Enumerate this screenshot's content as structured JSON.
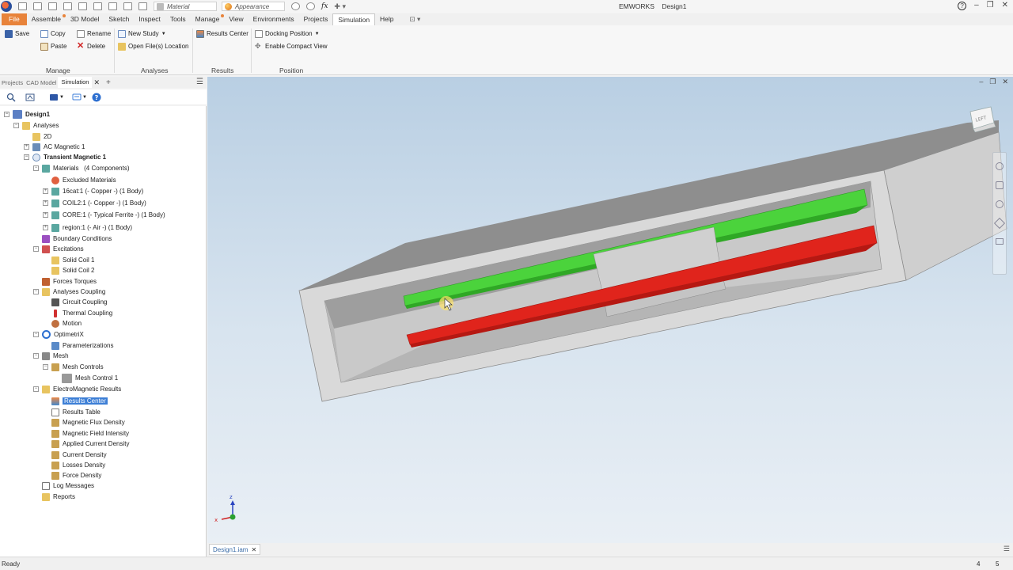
{
  "titlebar": {
    "app_title": "EMWORKS",
    "doc_title": "Design1",
    "material_combo": "Material",
    "appearance_combo": "Appearance",
    "help_symbol": "?"
  },
  "menu": {
    "items": [
      "File",
      "Assemble",
      "3D Model",
      "Sketch",
      "Inspect",
      "Tools",
      "Manage",
      "View",
      "Environments",
      "Projects",
      "Simulation",
      "Help"
    ],
    "active": "Simulation"
  },
  "ribbon": {
    "save": "Save",
    "copy": "Copy",
    "paste": "Paste",
    "rename": "Rename",
    "delete": "Delete",
    "new_study": "New Study",
    "open_location": "Open File(s) Location",
    "results_center": "Results Center",
    "docking_position": "Docking Position",
    "compact_view": "Enable Compact View",
    "groups": {
      "manage": "Manage",
      "analyses": "Analyses",
      "results": "Results",
      "position": "Position"
    }
  },
  "panel": {
    "tabs": [
      "Projects",
      "CAD Model",
      "Simulation"
    ],
    "active_tab": "Simulation",
    "plus": "+",
    "menu": "☰"
  },
  "tree": {
    "design": "Design1",
    "analyses": "Analyses",
    "twoD": "2D",
    "ac_magnetic": "AC Magnetic 1",
    "transient": "Transient Magnetic 1",
    "materials": "Materials",
    "materials_count": "(4 Components)",
    "excluded": "Excluded Materials",
    "mat1": "16cat:1   (- Copper -)  (1 Body)",
    "mat2": "COIL2:1   (- Copper -)  (1 Body)",
    "mat3": "CORE:1   (- Typical Ferrite -)  (1 Body)",
    "mat4": "region:1   (- Air -)  (1 Body)",
    "boundary": "Boundary Conditions",
    "excitations": "Excitations",
    "coil1": "Solid Coil 1",
    "coil2": "Solid Coil 2",
    "forces": "Forces Torques",
    "coupling": "Analyses Coupling",
    "circuit": "Circuit Coupling",
    "thermal": "Thermal Coupling",
    "motion": "Motion",
    "optimetrix": "OptimetriX",
    "param": "Parameterizations",
    "mesh": "Mesh",
    "mesh_controls": "Mesh Controls",
    "mesh_control1": "Mesh Control 1",
    "em_results": "ElectroMagnetic Results",
    "results_center": "Results Center",
    "results_table": "Results Table",
    "flux": "Magnetic Flux Density",
    "field": "Magnetic Field Intensity",
    "applied_current": "Applied Current Density",
    "current": "Current Density",
    "losses": "Losses Density",
    "force": "Force Density",
    "log": "Log Messages",
    "reports": "Reports"
  },
  "viewport": {
    "viewcube_label": "LEFT",
    "axis_z": "z",
    "axis_x": "x"
  },
  "doc_tab": "Design1.iam",
  "status": {
    "text": "Ready",
    "num1": "4",
    "num2": "5"
  },
  "colors": {
    "file_menu": "#e8833a",
    "selection": "#3d7fd6",
    "coil_green": "#4bd33c",
    "coil_red": "#e0241c",
    "core_gray": "#a8a8a8"
  }
}
